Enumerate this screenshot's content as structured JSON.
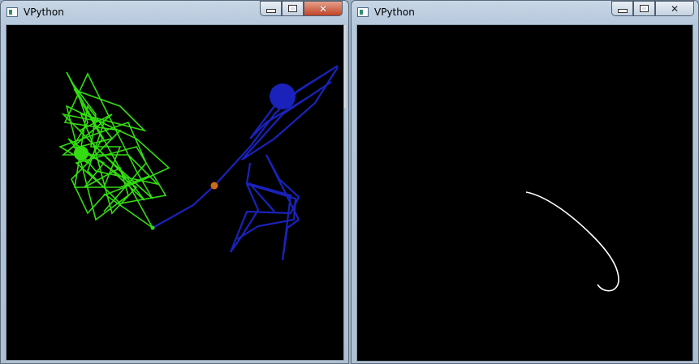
{
  "windows": {
    "left": {
      "title": "VPython"
    },
    "right": {
      "title": "VPython"
    }
  },
  "colors": {
    "green_trail": "#33dd11",
    "blue_trail": "#1a22bb",
    "white_trail": "#ffffff",
    "orange_ball": "#cc6a1a",
    "scene_background": "#000000"
  },
  "icons": {
    "app": "vpython-app-icon",
    "minimize": "minimize-icon",
    "maximize": "maximize-icon",
    "close": "close-icon"
  }
}
